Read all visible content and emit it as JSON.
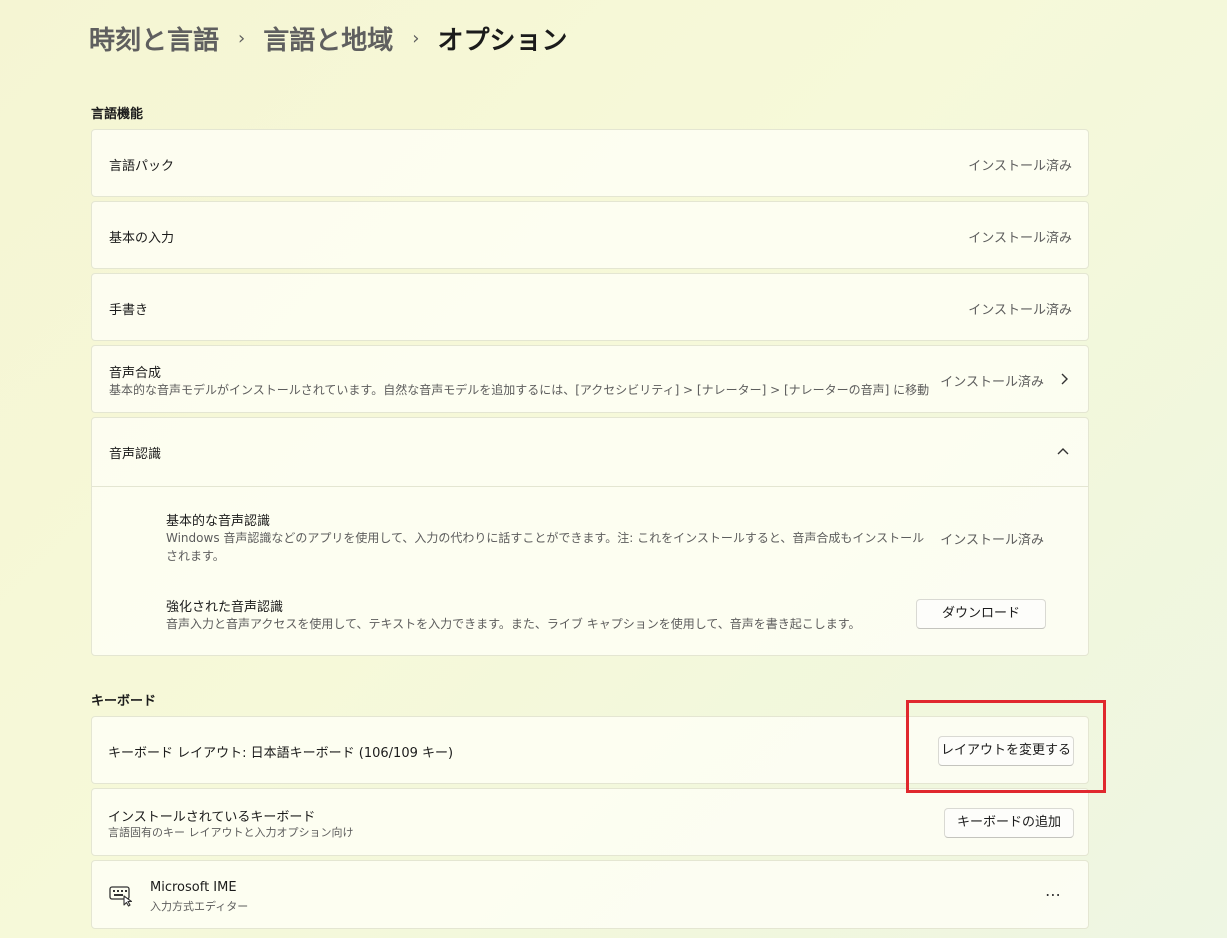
{
  "breadcrumb": {
    "items": [
      "時刻と言語",
      "言語と地域",
      "オプション"
    ],
    "separator": "›"
  },
  "language_features": {
    "title": "言語機能",
    "language_pack": {
      "label": "言語パック",
      "status": "インストール済み"
    },
    "basic_typing": {
      "label": "基本の入力",
      "status": "インストール済み"
    },
    "handwriting": {
      "label": "手書き",
      "status": "インストール済み"
    },
    "tts": {
      "label": "音声合成",
      "description": "基本的な音声モデルがインストールされています。自然な音声モデルを追加するには、[アクセシビリティ] > [ナレーター] > [ナレーターの音声] に移動",
      "status": "インストール済み"
    },
    "speech_recognition": {
      "label": "音声認識",
      "basic": {
        "label": "基本的な音声認識",
        "description": "Windows 音声認識などのアプリを使用して、入力の代わりに話すことができます。注: これをインストールすると、音声合成もインストールされます。",
        "status": "インストール済み"
      },
      "enhanced": {
        "label": "強化された音声認識",
        "description": "音声入力と音声アクセスを使用して、テキストを入力できます。また、ライブ キャプションを使用して、音声を書き起こします。",
        "button": "ダウンロード"
      }
    }
  },
  "keyboard": {
    "title": "キーボード",
    "layout": {
      "label": "キーボード レイアウト: 日本語キーボード (106/109 キー)",
      "button": "レイアウトを変更する"
    },
    "installed": {
      "label": "インストールされているキーボード",
      "description": "言語固有のキー レイアウトと入力オプション向け",
      "button": "キーボードの追加"
    },
    "ime": {
      "name": "Microsoft IME",
      "subtitle": "入力方式エディター",
      "icon": "keyboard-icon",
      "more": "⋯"
    }
  },
  "colors": {
    "highlight": "#e0282e",
    "background": "#f5f8d8"
  }
}
